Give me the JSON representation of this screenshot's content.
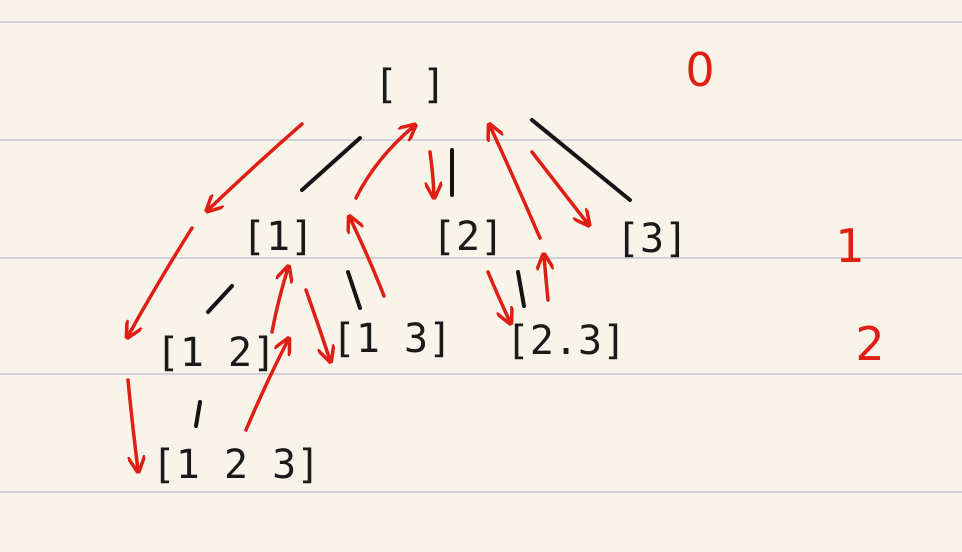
{
  "nodes": [
    {
      "id": "root",
      "label": "[ ]"
    },
    {
      "id": "n1",
      "label": "[1]"
    },
    {
      "id": "n2",
      "label": "[2]"
    },
    {
      "id": "n3",
      "label": "[3]"
    },
    {
      "id": "n12",
      "label": "[1 2]"
    },
    {
      "id": "n13",
      "label": "[1 3]"
    },
    {
      "id": "n23",
      "label": "[2.3]"
    },
    {
      "id": "n123",
      "label": "[1 2 3]"
    }
  ],
  "levels": [
    "0",
    "1",
    "2"
  ],
  "colors": {
    "paper": "#f8f4ea",
    "ink": "#141414",
    "arrow": "#e01e14",
    "ruled_line": "#d2d2da"
  }
}
